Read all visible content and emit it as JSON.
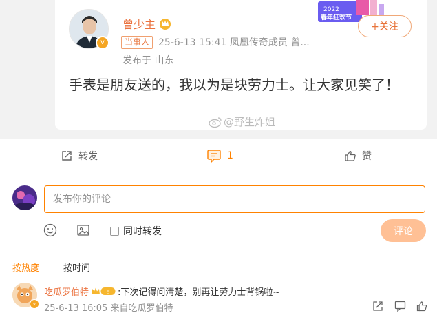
{
  "post": {
    "author": "曾少主",
    "role_tag": "当事人",
    "meta": "25-6-13 15:41  凤凰传奇成员 曾...",
    "location": "发布于 山东",
    "text": "手表是朋友送的，我以为是块劳力士。让大家见笑了！",
    "follow_label": "+关注",
    "banner_text": "2022 春年狂欢节",
    "watermark": "@野生炸姐"
  },
  "actions": {
    "repost": "转发",
    "comment_count": "1",
    "like": "赞"
  },
  "composer": {
    "placeholder": "发布你的评论",
    "also_repost": "同时转发",
    "submit": "评论"
  },
  "sort": {
    "hot": "按热度",
    "time": "按时间"
  },
  "comments": [
    {
      "user": "吃瓜罗伯特",
      "badge_text": "!",
      "text": ":下次记得问清楚，别再让劳力士背锅啦~",
      "meta": "25-6-13 16:05  来自吃瓜罗伯特"
    }
  ],
  "colors": {
    "accent": "#ff8200",
    "name": "#eb7340",
    "muted": "#939393"
  }
}
